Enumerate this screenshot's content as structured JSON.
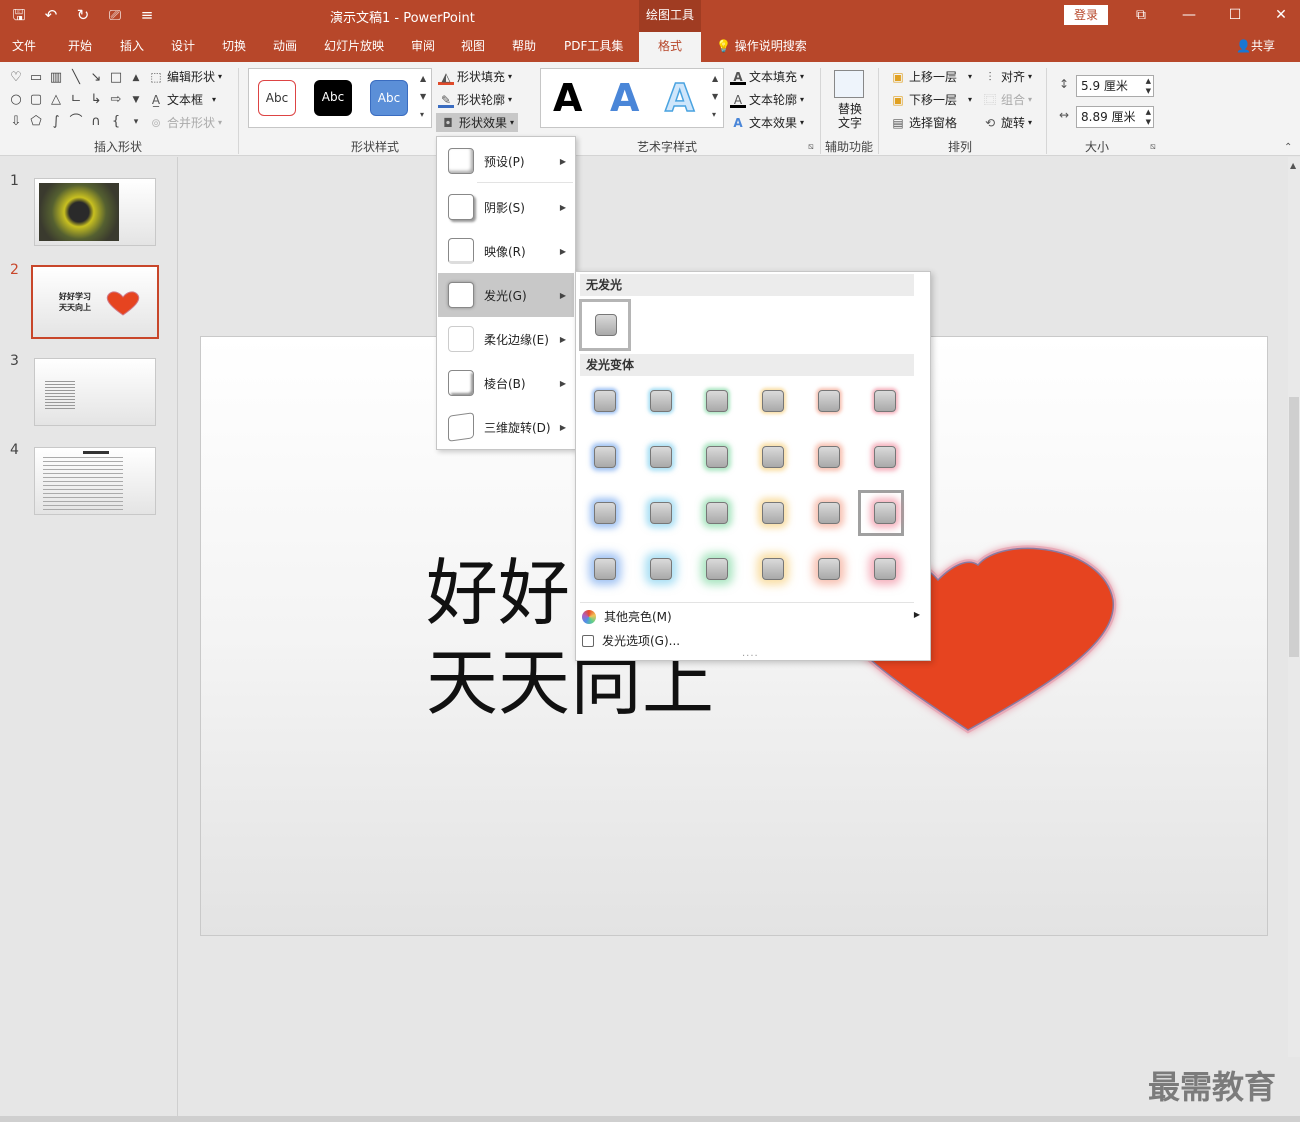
{
  "title_bar": {
    "doc_title": "演示文稿1  -  PowerPoint",
    "context_tab": "绘图工具",
    "login": "登录"
  },
  "tabs": [
    "文件",
    "开始",
    "插入",
    "设计",
    "切换",
    "动画",
    "幻灯片放映",
    "审阅",
    "视图",
    "帮助",
    "PDF工具集",
    "格式"
  ],
  "active_tab": "格式",
  "search_label": "操作说明搜索",
  "share_label": "共享",
  "ribbon": {
    "insert_shapes": {
      "label": "插入形状",
      "edit_shape": "编辑形状",
      "text_box": "文本框",
      "merge_shapes": "合并形状"
    },
    "shape_styles": {
      "label": "形状样式",
      "presets": [
        "Abc",
        "Abc",
        "Abc"
      ],
      "fill": "形状填充",
      "outline": "形状轮廓",
      "effects": "形状效果"
    },
    "wordart_styles": {
      "label": "艺术字样式",
      "letters": [
        "A",
        "A",
        "A"
      ],
      "text_fill": "文本填充",
      "text_outline": "文本轮廓",
      "text_effects": "文本效果"
    },
    "accessibility": {
      "label": "辅助功能",
      "alt_text_line1": "替换",
      "alt_text_line2": "文字"
    },
    "arrange": {
      "label": "排列",
      "bring_forward": "上移一层",
      "send_backward": "下移一层",
      "selection_pane": "选择窗格",
      "align": "对齐",
      "group": "组合",
      "rotate": "旋转"
    },
    "size": {
      "label": "大小",
      "height": "5.9 厘米",
      "width": "8.89 厘米"
    }
  },
  "slides": {
    "numbers": [
      "1",
      "2",
      "3",
      "4"
    ],
    "slide2_thumb_line1": "好好学习",
    "slide2_thumb_line2": "天天向上"
  },
  "slide_content": {
    "line1": "好好",
    "line2": "天天向上"
  },
  "effects_menu": {
    "items": [
      {
        "label": "预设(P)"
      },
      {
        "label": "阴影(S)"
      },
      {
        "label": "映像(R)"
      },
      {
        "label": "发光(G)"
      },
      {
        "label": "柔化边缘(E)"
      },
      {
        "label": "棱台(B)"
      },
      {
        "label": "三维旋转(D)"
      }
    ],
    "active_index": 3
  },
  "glow_panel": {
    "no_glow_header": "无发光",
    "variants_header": "发光变体",
    "more_colors": "其他亮色(M)",
    "glow_options": "发光选项(G)...",
    "colors": [
      "#4f8fe8",
      "#5ec3ea",
      "#5fcf8a",
      "#f4c256",
      "#f08a6e",
      "#ec6f86"
    ],
    "rows": 4,
    "selected": {
      "row": 3,
      "col": 6
    }
  },
  "watermark": "最需教育"
}
